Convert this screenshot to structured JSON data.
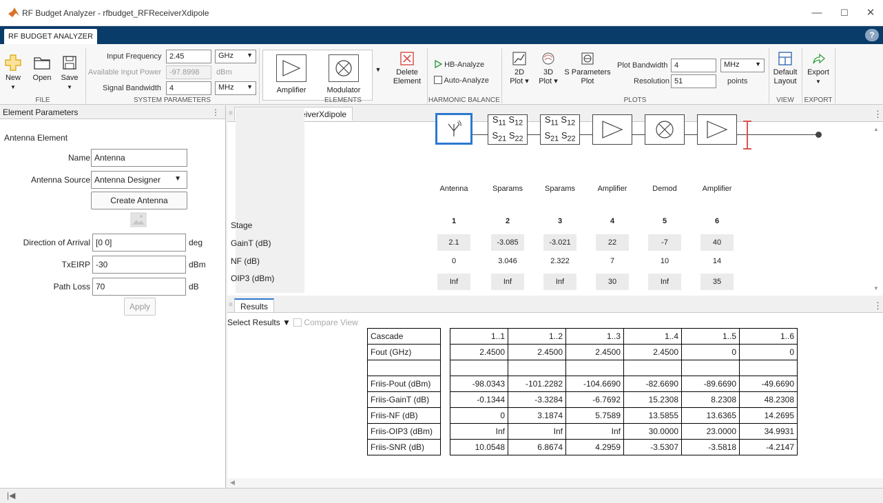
{
  "window": {
    "title": "RF Budget Analyzer - rfbudget_RFReceiverXdipole"
  },
  "tab": {
    "label": "RF BUDGET ANALYZER"
  },
  "toolstrip": {
    "file": {
      "new": "New",
      "open": "Open",
      "save": "Save",
      "section": "FILE"
    },
    "system": {
      "input_frequency_label": "Input Frequency",
      "input_frequency_value": "2.45",
      "input_frequency_unit": "GHz",
      "available_power_label": "Available Input Power",
      "available_power_value": "-97.8998",
      "available_power_unit": "dBm",
      "signal_bandwidth_label": "Signal Bandwidth",
      "signal_bandwidth_value": "4",
      "signal_bandwidth_unit": "MHz",
      "section": "SYSTEM PARAMETERS"
    },
    "elements": {
      "amplifier": "Amplifier",
      "modulator": "Modulator",
      "delete_line1": "Delete",
      "delete_line2": "Element",
      "section": "ELEMENTS"
    },
    "harmonic": {
      "hb_analyze": "HB-Analyze",
      "auto_analyze": "Auto-Analyze",
      "section": "HARMONIC BALANCE"
    },
    "plots": {
      "plot2d_line1": "2D",
      "plot2d_line2": "Plot",
      "plot3d_line1": "3D",
      "plot3d_line2": "Plot",
      "sparam_line1": "S Parameters",
      "sparam_line2": "Plot",
      "plot_bandwidth_label": "Plot Bandwidth",
      "plot_bandwidth_value": "4",
      "plot_bandwidth_unit": "MHz",
      "resolution_label": "Resolution",
      "resolution_value": "51",
      "resolution_unit": "points",
      "section": "PLOTS"
    },
    "view": {
      "default_line1": "Default",
      "default_line2": "Layout",
      "section": "VIEW"
    },
    "export": {
      "label": "Export",
      "section": "EXPORT"
    }
  },
  "element_params": {
    "header": "Element Parameters",
    "title": "Antenna Element",
    "name_label": "Name",
    "name_value": "Antenna",
    "source_label": "Antenna Source",
    "source_value": "Antenna Designer",
    "create_button": "Create Antenna",
    "doa_label": "Direction of Arrival",
    "doa_value": "[0 0]",
    "doa_unit": "deg",
    "txeirp_label": "TxEIRP",
    "txeirp_value": "-30",
    "txeirp_unit": "dBm",
    "pathloss_label": "Path Loss",
    "pathloss_value": "70",
    "pathloss_unit": "dB",
    "apply_button": "Apply"
  },
  "canvas": {
    "tab": "rfbudget_RFReceiverXdipole",
    "sparam": {
      "s11": "S",
      "s11_sub": "11",
      "s12": "S",
      "s12_sub": "12",
      "s21": "S",
      "s21_sub": "21",
      "s22": "S",
      "s22_sub": "22"
    },
    "row_labels": {
      "stage": "Stage",
      "gain": "GainT (dB)",
      "nf": "NF (dB)",
      "oip3": "OIP3 (dBm)"
    },
    "stages": [
      {
        "name": "Antenna",
        "num": "1",
        "gain": "2.1",
        "nf": "0",
        "oip3": "Inf"
      },
      {
        "name": "Sparams",
        "num": "2",
        "gain": "-3.085",
        "nf": "3.046",
        "oip3": "Inf"
      },
      {
        "name": "Sparams",
        "num": "3",
        "gain": "-3.021",
        "nf": "2.322",
        "oip3": "Inf"
      },
      {
        "name": "Amplifier",
        "num": "4",
        "gain": "22",
        "nf": "7",
        "oip3": "30"
      },
      {
        "name": "Demod",
        "num": "5",
        "gain": "-7",
        "nf": "10",
        "oip3": "Inf"
      },
      {
        "name": "Amplifier",
        "num": "6",
        "gain": "40",
        "nf": "14",
        "oip3": "35"
      }
    ]
  },
  "results": {
    "tab": "Results",
    "select_label": "Select Results",
    "compare_label": "Compare View",
    "columns": [
      "1..1",
      "1..2",
      "1..3",
      "1..4",
      "1..5",
      "1..6"
    ],
    "rows": [
      {
        "label": "Cascade",
        "values": [
          "1..1",
          "1..2",
          "1..3",
          "1..4",
          "1..5",
          "1..6"
        ]
      },
      {
        "label": "Fout (GHz)",
        "values": [
          "2.4500",
          "2.4500",
          "2.4500",
          "2.4500",
          "0",
          "0"
        ]
      },
      {
        "label": "",
        "values": [
          "",
          "",
          "",
          "",
          "",
          ""
        ]
      },
      {
        "label": "Friis-Pout (dBm)",
        "values": [
          "-98.0343",
          "-101.2282",
          "-104.6690",
          "-82.6690",
          "-89.6690",
          "-49.6690"
        ]
      },
      {
        "label": "Friis-GainT (dB)",
        "values": [
          "-0.1344",
          "-3.3284",
          "-6.7692",
          "15.2308",
          "8.2308",
          "48.2308"
        ]
      },
      {
        "label": "Friis-NF (dB)",
        "values": [
          "0",
          "3.1874",
          "5.7589",
          "13.5855",
          "13.6365",
          "14.2695"
        ]
      },
      {
        "label": "Friis-OIP3 (dBm)",
        "values": [
          "Inf",
          "Inf",
          "Inf",
          "30.0000",
          "23.0000",
          "34.9931"
        ]
      },
      {
        "label": "Friis-SNR (dB)",
        "values": [
          "10.0548",
          "6.8674",
          "4.2959",
          "-3.5307",
          "-3.5818",
          "-4.2147"
        ]
      }
    ]
  },
  "colors": {
    "accent": "#2b78d0",
    "tabstrip": "#0a3c6a",
    "delete": "#d9534f",
    "hb_green": "#2e9c3a",
    "new_yellow": "#f2c230"
  }
}
